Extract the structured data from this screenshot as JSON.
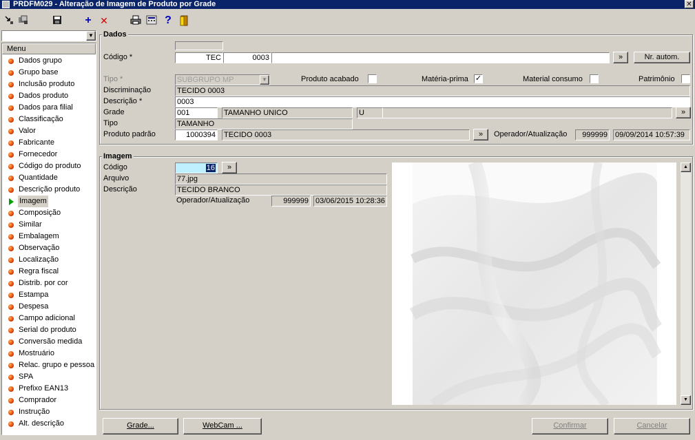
{
  "window": {
    "title": "PRDFM029 - Alteração de Imagem de Produto por Grade",
    "close": "✕"
  },
  "toolbar": {
    "icons": [
      "tree-icon",
      "copy-icon",
      "save-icon",
      "add-icon",
      "delete-icon",
      "print-icon",
      "calculator-icon",
      "help-icon",
      "exit-icon"
    ],
    "add_glyph": "+",
    "delete_glyph": "✕",
    "help_glyph": "?",
    "combo_value": ""
  },
  "menu": {
    "header": "Menu",
    "items": [
      "Dados grupo",
      "Grupo base",
      "Inclusão produto",
      "Dados produto",
      "Dados para filial",
      "Classificação",
      "Valor",
      "Fabricante",
      "Fornecedor",
      "Código do produto",
      "Quantidade",
      "Descrição produto",
      "Imagem",
      "Composição",
      "Similar",
      "Embalagem",
      "Observação",
      "Localização",
      "Regra fiscal",
      "Distrib. por cor",
      "Estampa",
      "Despesa",
      "Campo adicional",
      "Serial do produto",
      "Conversão medida",
      "Mostruário",
      "Relac. grupo e pessoa",
      "SPA",
      "Prefixo EAN13",
      "Comprador",
      "Instrução",
      "Alt. descrição"
    ],
    "selected_index": 12
  },
  "dados": {
    "title": "Dados",
    "codigo_label": "Código *",
    "codigo_prefix": "TEC",
    "codigo_num": "0003",
    "codigo_ext": "",
    "nav_btn": "»",
    "nr_autom_btn": "Nr. autom.",
    "tipo_label": "Tipo *",
    "tipo_value": "SUBGRUPO MP",
    "produto_acabado_label": "Produto acabado",
    "produto_acabado_checked": false,
    "materia_prima_label": "Matéria-prima",
    "materia_prima_checked": true,
    "material_consumo_label": "Material consumo",
    "material_consumo_checked": false,
    "patrimonio_label": "Patrimônio",
    "patrimonio_checked": false,
    "check_glyph": "✓",
    "discriminacao_label": "Discriminação",
    "discriminacao_value": "TECIDO 0003",
    "descricao_label": "Descrição *",
    "descricao_value": "0003",
    "grade_label": "Grade",
    "grade_code": "001",
    "grade_desc": "TAMANHO UNICO",
    "grade_u": "U",
    "tipo2_label": "Tipo",
    "tipo2_value": "TAMANHO",
    "produto_padrao_label": "Produto padrão",
    "produto_padrao_code": "1000394",
    "produto_padrao_desc": "TECIDO 0003",
    "operador_label": "Operador/Atualização",
    "operador_value": "999999",
    "atualizacao_value": "09/09/2014 10:57:39"
  },
  "imagem": {
    "title": "Imagem",
    "codigo_label": "Código",
    "codigo_value": "16",
    "arquivo_label": "Arquivo",
    "arquivo_value": "77.jpg",
    "descricao_label": "Descrição",
    "descricao_value": "TECIDO BRANCO",
    "operador_label": "Operador/Atualização",
    "operador_value": "999999",
    "atualizacao_value": "03/06/2015 10:28:36"
  },
  "footer": {
    "grade_btn": "Grade...",
    "webcam_btn": "WebCam ...",
    "confirmar_btn": "Confirmar",
    "cancelar_btn": "Cancelar"
  }
}
